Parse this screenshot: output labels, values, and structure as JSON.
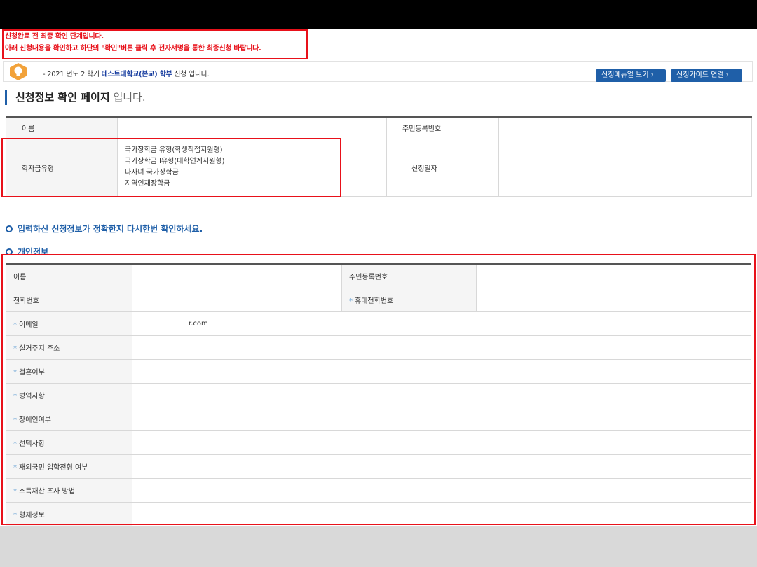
{
  "notice": {
    "line1": "신청완료 전 최종 확인 단계입니다.",
    "line2": "아래 신청내용을 확인하고 하단의 \"확인\"버튼 클릭 후 전자서명을 통한 최종신청 바랍니다."
  },
  "info_bar": {
    "prefix": "- 2021 년도 2 학기",
    "school": "테스트대학교(본교) 학부",
    "suffix": "신청 입니다.",
    "menu_button": "신청메뉴얼 보기",
    "guide_button": "신청가이드 연결",
    "icon": "lightbulb-icon"
  },
  "page_title": {
    "strong": "신청정보 확인 페이지",
    "light": "입니다."
  },
  "summary": {
    "name_label": "이름",
    "name_value": "",
    "rrn_label": "주민등록번호",
    "rrn_value": "",
    "type_label": "학자금유형",
    "types": [
      "국가장학금I유형(학생직접지원형)",
      "국가장학금II유형(대학연계지원형)",
      "다자녀 국가장학금",
      "지역인재장학금"
    ],
    "date_label": "신청일자",
    "date_value": ""
  },
  "confirm_message": "입력하신 신청정보가 정확한지 다시한번 확인하세요.",
  "personal_title": "개인정보",
  "personal": {
    "name_label": "이름",
    "name_value": "",
    "rrn_label": "주민등록번호",
    "rrn_value": "",
    "phone_label": "전화번호",
    "phone_value": "",
    "mobile_label": "휴대전화번호",
    "mobile_value": "",
    "email_label": "이메일",
    "email_value": "r.com",
    "address_label": "실거주지 주소",
    "marriage_label": "결혼여부",
    "military_label": "병역사항",
    "disability_label": "장애인여부",
    "optional_label": "선택사항",
    "overseas_label": "재외국민 입학전형 여부",
    "income_label": "소득재산 조사 방법",
    "sibling_label": "형제정보",
    "req_mark": "*"
  },
  "colors": {
    "accent": "#1f5fa8",
    "highlight_red": "#e8111a"
  }
}
